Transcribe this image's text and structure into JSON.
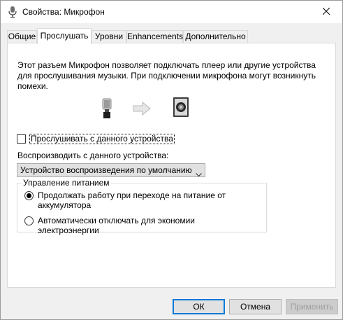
{
  "window": {
    "title": "Свойства: Микрофон",
    "icon": "microphone-icon",
    "close_icon": "close-icon"
  },
  "tabs": [
    {
      "label": "Общие",
      "active": false
    },
    {
      "label": "Прослушать",
      "active": true
    },
    {
      "label": "Уровни",
      "active": false
    },
    {
      "label": "Enhancements",
      "active": false
    },
    {
      "label": "Дополнительно",
      "active": false
    }
  ],
  "panel": {
    "description": "Этот разъем Микрофон позволяет подключать плеер или другие устройства для прослушивания музыки. При подключении микрофона могут возникнуть помехи.",
    "graphic_icons": [
      "microphone-icon",
      "arrow-right-icon",
      "speaker-icon"
    ],
    "listen_checkbox": {
      "label": "Прослушивать с данного устройства",
      "checked": false
    },
    "playback_label": "Воспроизводить с данного устройства:",
    "playback_select": {
      "value": "Устройство воспроизведения по умолчанию"
    },
    "power": {
      "legend": "Управление питанием",
      "options": [
        {
          "label": "Продолжать работу при переходе на питание от аккумулятора",
          "checked": true
        },
        {
          "label": "Автоматически отключать для экономии электроэнергии",
          "checked": false
        }
      ]
    }
  },
  "buttons": {
    "ok": "ОК",
    "cancel": "Отмена",
    "apply": "Применить"
  }
}
